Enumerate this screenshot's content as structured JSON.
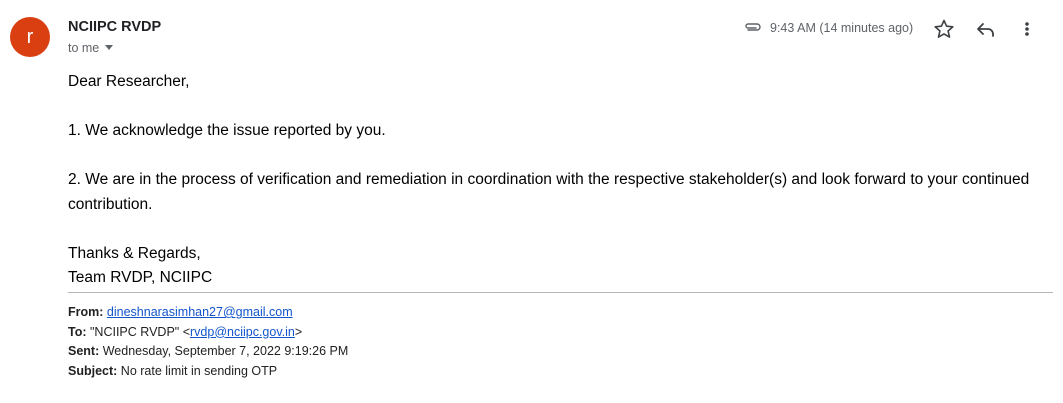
{
  "sender": {
    "avatar_letter": "r",
    "avatar_color": "#d93f10",
    "name": "NCIIPC RVDP",
    "to_label": "to me"
  },
  "meta": {
    "time": "9:43 AM (14 minutes ago)",
    "icons": [
      "paperclip-icon",
      "star-icon",
      "reply-icon",
      "more-vert-icon"
    ]
  },
  "message": {
    "greeting": "Dear Researcher,",
    "point1": "1. We acknowledge the issue reported by you.",
    "point2": "2. We are in the process of verification and remediation in coordination with the respective stakeholder(s) and look forward to your continued contribution.",
    "signoff1": "Thanks & Regards,",
    "signoff2": "Team RVDP, NCIIPC"
  },
  "quoted": {
    "from_label": "From:",
    "from_email": "dineshnarasimhan27@gmail.com",
    "to_label": "To:",
    "to_name": "\"NCIIPC RVDP\" <",
    "to_email": "rvdp@nciipc.gov.in",
    "to_close": ">",
    "sent_label": "Sent:",
    "sent_value": "Wednesday, September 7, 2022 9:19:26 PM",
    "subject_label": "Subject:",
    "subject_value": "No rate limit in sending OTP"
  },
  "colors": {
    "link": "#1155cc",
    "muted": "#5f6368",
    "avatar": "#d93f10"
  }
}
